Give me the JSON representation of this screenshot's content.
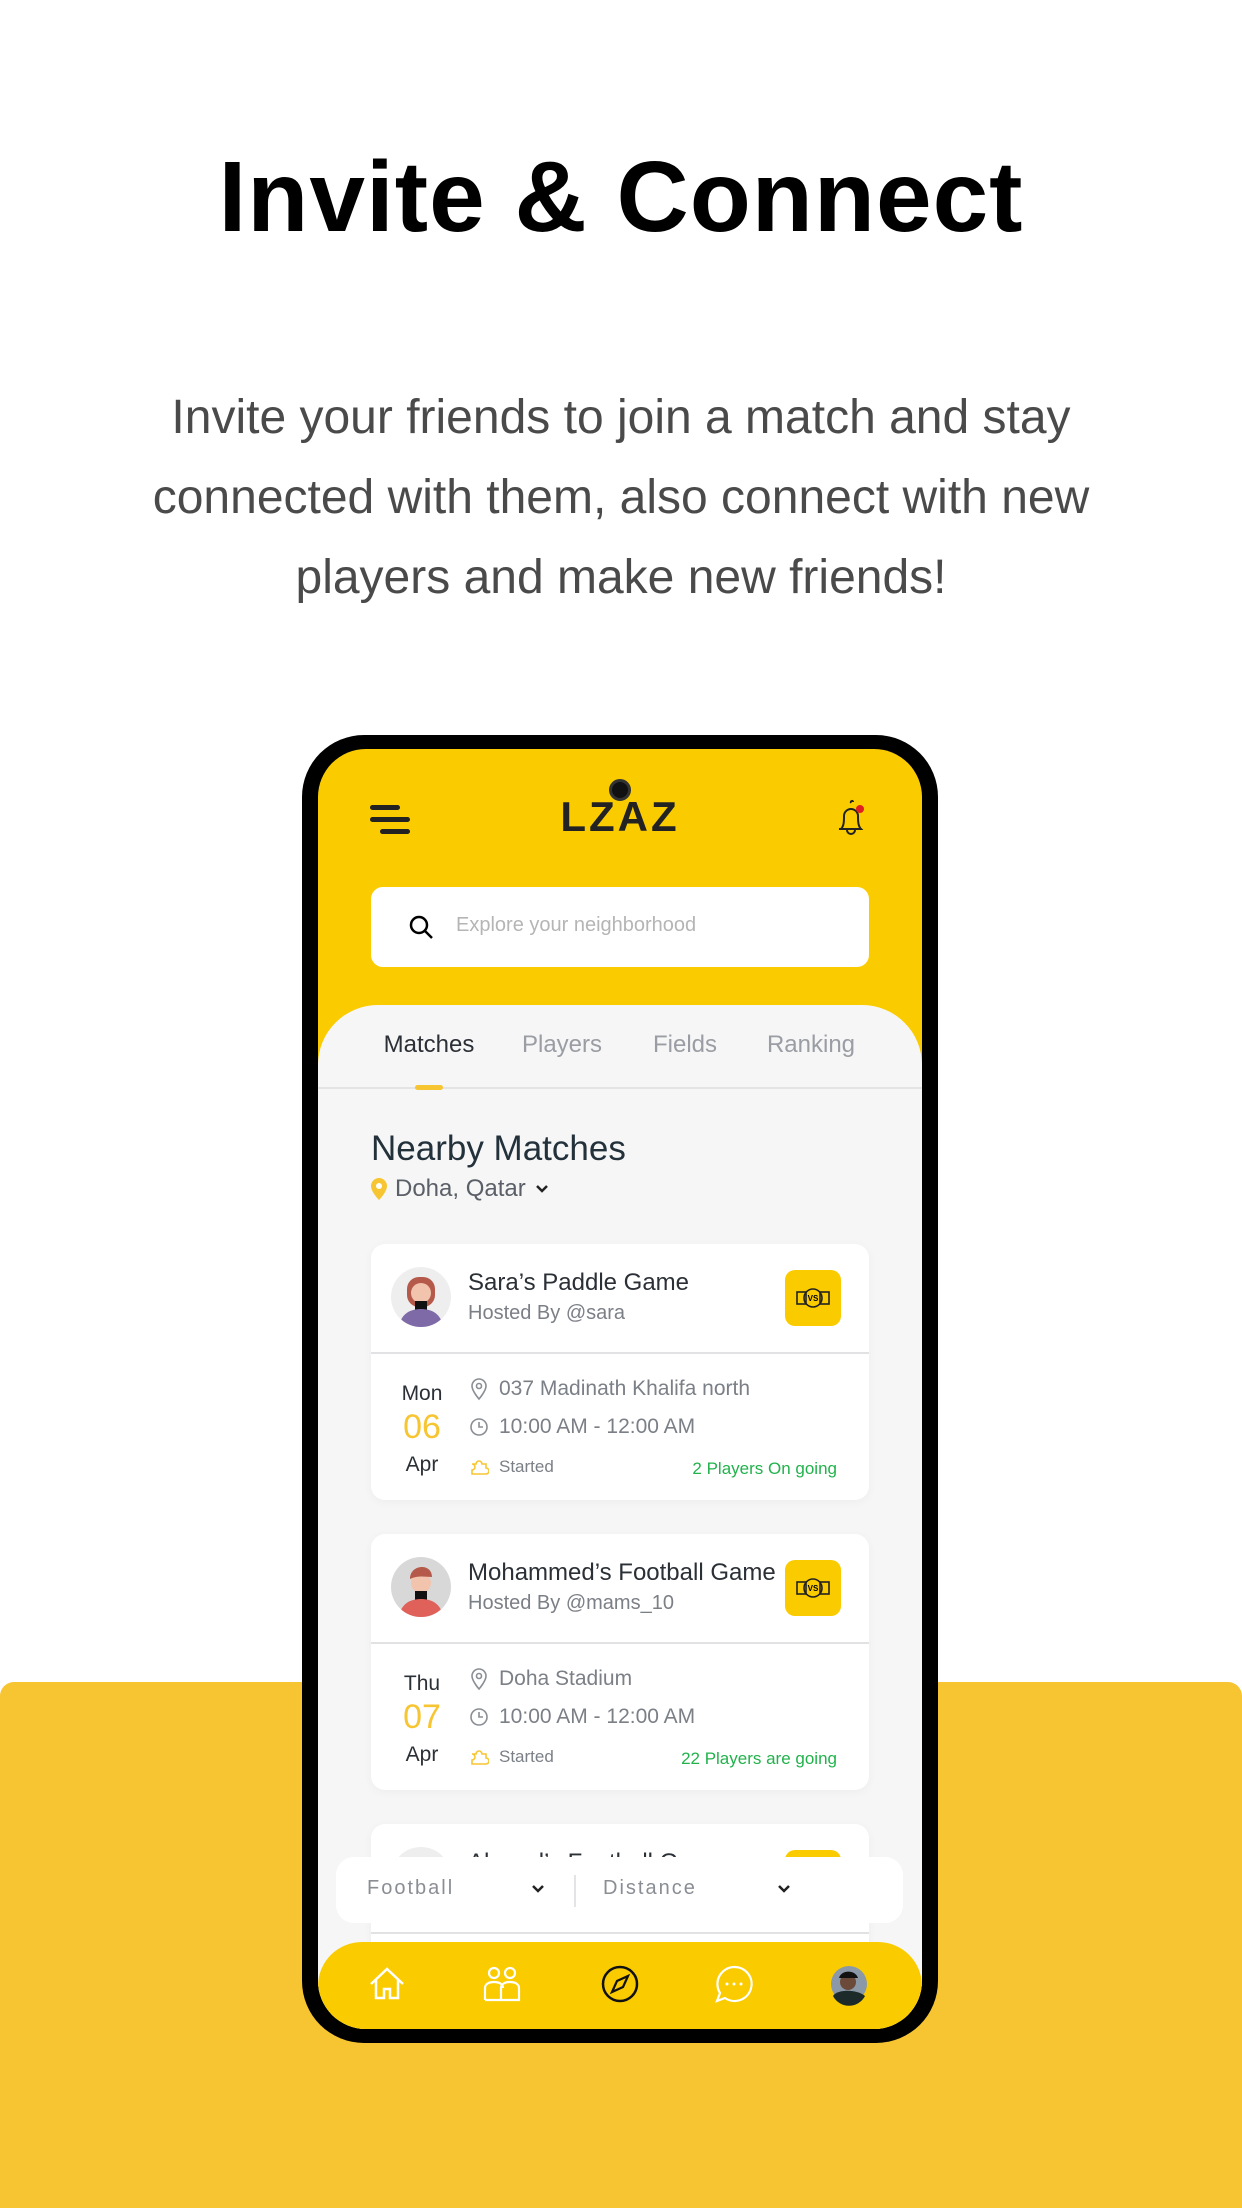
{
  "headline": "Invite & Connect",
  "description": "Invite your friends to join a match and stay connected with them, also connect with new players and make new friends!",
  "colors": {
    "brand_yellow": "#FACC00",
    "accent_yellow": "#F7C531",
    "green": "#22b24c"
  },
  "app": {
    "logo": "LZAZ",
    "search": {
      "placeholder": "Explore your neighborhood"
    },
    "tabs": [
      {
        "label": "Matches",
        "active": true
      },
      {
        "label": "Players"
      },
      {
        "label": "Fields"
      },
      {
        "label": "Ranking"
      }
    ],
    "section_title": "Nearby Matches",
    "location": "Doha, Qatar",
    "matches": [
      {
        "title": "Sara’s Paddle Game",
        "host": "Hosted By @sara",
        "dow": "Mon",
        "day": "06",
        "month": "Apr",
        "place": "037 Madinath Khalifa north",
        "time": "10:00 AM - 12:00 AM",
        "status": "Started",
        "players": "2 Players On going"
      },
      {
        "title": "Mohammed’s Football Game",
        "host": "Hosted By @mams_10",
        "dow": "Thu",
        "day": "07",
        "month": "Apr",
        "place": "Doha Stadium",
        "time": "10:00 AM - 12:00 AM",
        "status": "Started",
        "players": "22 Players are going"
      },
      {
        "title": "Ahmed’s Football Game"
      }
    ],
    "filters": {
      "sport": "Football",
      "distance": "Distance"
    },
    "nav": [
      "home-icon",
      "friends-icon",
      "compass-icon",
      "chat-icon",
      "profile-avatar"
    ]
  }
}
